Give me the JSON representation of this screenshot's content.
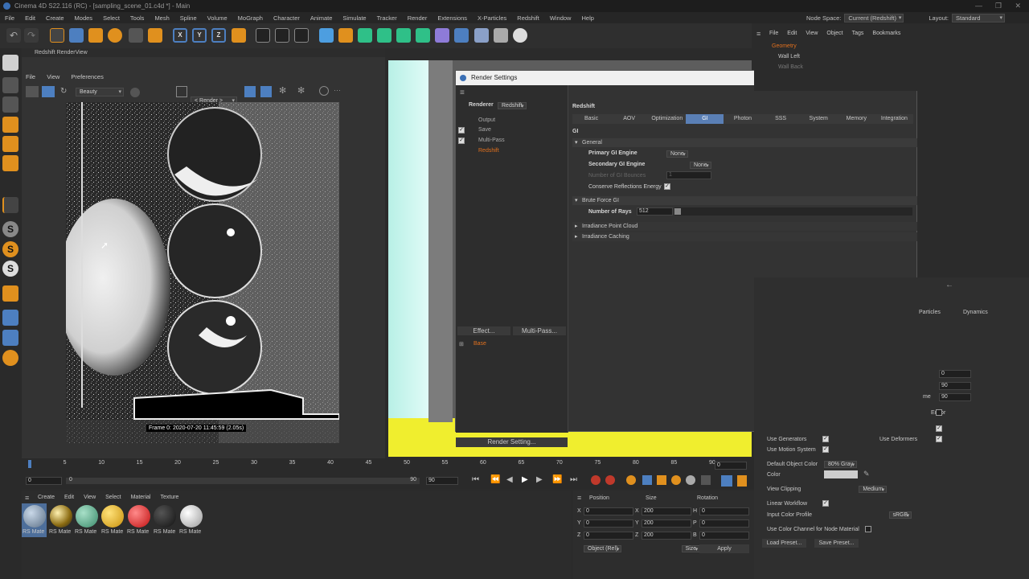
{
  "window": {
    "title": "Cinema 4D S22.116 (RC) - [sampling_scene_01.c4d *] - Main"
  },
  "menubar": {
    "items": [
      "File",
      "Edit",
      "Create",
      "Modes",
      "Select",
      "Tools",
      "Mesh",
      "Spline",
      "Volume",
      "MoGraph",
      "Character",
      "Animate",
      "Simulate",
      "Tracker",
      "Render",
      "Extensions",
      "X-Particles",
      "Redshift",
      "Window",
      "Help"
    ],
    "node_space_label": "Node Space:",
    "node_space_value": "Current (Redshift)",
    "layout_label": "Layout:",
    "layout_value": "Standard"
  },
  "renderview": {
    "title": "Redshift RenderView",
    "menu": [
      "File",
      "View",
      "Preferences"
    ],
    "aov": "Beauty",
    "render_mode": "< Render >",
    "frame_info": "Frame 0: 2020-07-20 11:45:59 (2.05s)"
  },
  "objmgr": {
    "menu": [
      "File",
      "Edit",
      "View",
      "Object",
      "Tags",
      "Bookmarks"
    ],
    "items": [
      "Geometry",
      "Wall Left",
      "Wall Back"
    ]
  },
  "dialog": {
    "title": "Render Settings",
    "renderer_label": "Renderer",
    "renderer_value": "Redshift",
    "tree": [
      "Output",
      "Save",
      "Multi-Pass",
      "Redshift"
    ],
    "effect_btn": "Effect...",
    "multipass_btn": "Multi-Pass...",
    "base": "Base",
    "render_setting_btn": "Render Setting...",
    "section_title": "Redshift",
    "tabs": [
      "Basic",
      "AOV",
      "Optimization",
      "GI",
      "Photon",
      "SSS",
      "System",
      "Memory",
      "Integration"
    ],
    "active_tab": "GI",
    "gi_label": "GI",
    "general": "General",
    "primary_gi_label": "Primary GI Engine",
    "primary_gi_value": "None",
    "secondary_gi_label": "Secondary GI Engine",
    "secondary_gi_value": "None",
    "bounces_label": "Number of GI Bounces",
    "bounces_value": "1",
    "conserve_label": "Conserve Reflections Energy",
    "brute_force": "Brute Force GI",
    "rays_label": "Number of Rays",
    "rays_value": "512",
    "irradiance_point": "Irradiance Point Cloud",
    "irradiance_caching": "Irradiance Caching"
  },
  "timeline": {
    "ticks": [
      "0",
      "5",
      "10",
      "15",
      "20",
      "25",
      "30",
      "35",
      "40",
      "45",
      "50",
      "55",
      "60",
      "65",
      "70",
      "75",
      "80",
      "85",
      "90"
    ],
    "start": "0",
    "end_field": "0",
    "end": "90",
    "end2": "90",
    "frame_field": "0"
  },
  "materials": {
    "menu": [
      "Create",
      "Edit",
      "View",
      "Select",
      "Material",
      "Texture"
    ],
    "items": [
      "RS Mate",
      "RS Mate",
      "RS Mate",
      "RS Mate",
      "RS Mate",
      "RS Mate",
      "RS Mate"
    ]
  },
  "coords": {
    "headers": [
      "Position",
      "Size",
      "Rotation"
    ],
    "rows": [
      {
        "axis": "X",
        "pos": "0",
        "size_axis": "X",
        "size": "200",
        "rot_axis": "H",
        "rot": "0"
      },
      {
        "axis": "Y",
        "pos": "0",
        "size_axis": "Y",
        "size": "200",
        "rot_axis": "P",
        "rot": "0"
      },
      {
        "axis": "Z",
        "pos": "0",
        "size_axis": "Z",
        "size": "200",
        "rot_axis": "B",
        "rot": "0"
      }
    ],
    "mode": "Object (Rel)",
    "size_mode": "Size",
    "apply": "Apply"
  },
  "attr": {
    "tabs": [
      "Particles",
      "Dynamics"
    ],
    "vals": [
      "0",
      "90",
      "90"
    ],
    "me_label": "me",
    "editor_label": "Editor",
    "use_generators": "Use Generators",
    "use_deformers": "Use Deformers",
    "use_motion": "Use Motion System",
    "default_color_label": "Default Object Color",
    "default_color_value": "80% Gray",
    "color_label": "Color",
    "view_clipping_label": "View Clipping",
    "view_clipping_value": "Medium",
    "linear_workflow": "Linear Workflow",
    "input_profile_label": "Input Color Profile",
    "input_profile_value": "sRGB",
    "use_color_channel": "Use Color Channel for Node Material",
    "load_preset": "Load Preset...",
    "save_preset": "Save Preset..."
  }
}
